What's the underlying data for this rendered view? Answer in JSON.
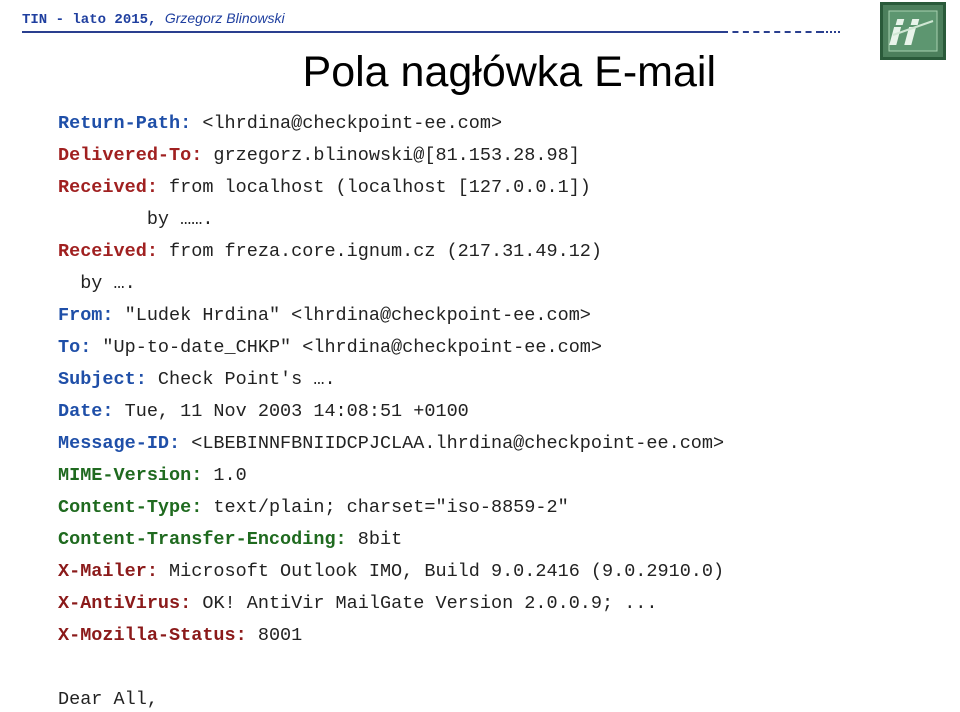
{
  "header": {
    "course": "TIN - lato 2015,",
    "author": "Grzegorz Blinowski",
    "logo_name": "ii-logo"
  },
  "title": "Pola nagłówka E-mail",
  "lines": [
    {
      "key": "Return-Path:",
      "value": " <lhrdina@checkpoint-ee.com>",
      "key_color": "#1f4fa8"
    },
    {
      "key": "Delivered-To:",
      "value": " grzegorz.blinowski@[81.153.28.98]",
      "key_color": "#a02020"
    },
    {
      "key": "Received:",
      "value": " from localhost (localhost [127.0.0.1])",
      "key_color": "#a02020"
    },
    {
      "key": "",
      "value": "        by …….",
      "key_color": "#a02020"
    },
    {
      "key": "Received:",
      "value": " from freza.core.ignum.cz (217.31.49.12)",
      "key_color": "#a02020"
    },
    {
      "key": "",
      "value": "  by ….",
      "key_color": "#a02020"
    },
    {
      "key": "From:",
      "value": " \"Ludek Hrdina\" <lhrdina@checkpoint-ee.com>",
      "key_color": "#1f4fa8"
    },
    {
      "key": "To:",
      "value": " \"Up-to-date_CHKP\" <lhrdina@checkpoint-ee.com>",
      "key_color": "#1f4fa8"
    },
    {
      "key": "Subject:",
      "value": " Check Point's ….",
      "key_color": "#1f4fa8"
    },
    {
      "key": "Date:",
      "value": " Tue, 11 Nov 2003 14:08:51 +0100",
      "key_color": "#1f4fa8"
    },
    {
      "key": "Message-ID:",
      "value": " <LBEBINNFBNIIDCPJCLAA.lhrdina@checkpoint-ee.com>",
      "key_color": "#1f4fa8"
    },
    {
      "key": "MIME-Version:",
      "value": " 1.0",
      "key_color": "#1f6a1f"
    },
    {
      "key": "Content-Type:",
      "value": " text/plain; charset=\"iso-8859-2\"",
      "key_color": "#1f6a1f"
    },
    {
      "key": "Content-Transfer-Encoding:",
      "value": " 8bit",
      "key_color": "#1f6a1f"
    },
    {
      "key": "X-Mailer:",
      "value": " Microsoft Outlook IMO, Build 9.0.2416 (9.0.2910.0)",
      "key_color": "#8b1a1a"
    },
    {
      "key": "X-AntiVirus:",
      "value": " OK! AntiVir MailGate Version 2.0.0.9; ...",
      "key_color": "#8b1a1a"
    },
    {
      "key": "X-Mozilla-Status:",
      "value": " 8001",
      "key_color": "#8b1a1a"
    },
    {
      "key": "",
      "value": "",
      "key_color": "#000000"
    },
    {
      "key": "",
      "value": "Dear All,",
      "key_color": "#000000"
    }
  ]
}
